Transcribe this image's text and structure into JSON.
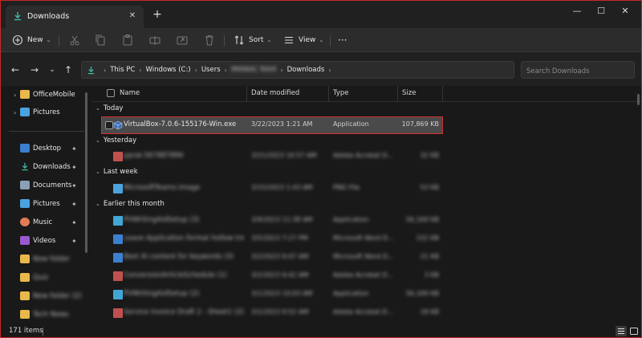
{
  "window": {
    "tab_title": "Downloads",
    "tab_close_glyph": "✕",
    "new_tab_glyph": "+",
    "minimize_glyph": "—",
    "maximize_glyph": "☐",
    "close_glyph": "✕"
  },
  "toolbar": {
    "new_label": "New",
    "sort_label": "Sort",
    "view_label": "View",
    "more_glyph": "···"
  },
  "address": {
    "crumbs": [
      "This PC",
      "Windows (C:)",
      "Users",
      "IMANAC RAHI",
      "Downloads"
    ],
    "search_placeholder": "Search Downloads"
  },
  "nav": {
    "items": [
      {
        "label": "OfficeMobile",
        "color": "#e8b84a"
      },
      {
        "label": "Pictures",
        "color": "#4aa3df"
      },
      {
        "label": "Desktop",
        "color": "#3b7fd0"
      },
      {
        "label": "Downloads",
        "color": "#3fb8a5"
      },
      {
        "label": "Documents",
        "color": "#8aa0b8"
      },
      {
        "label": "Pictures",
        "color": "#4aa3df"
      },
      {
        "label": "Music",
        "color": "#e07b54"
      },
      {
        "label": "Videos",
        "color": "#9b59d0"
      },
      {
        "label": "New folder",
        "color": "#e8b84a"
      },
      {
        "label": "Quiz",
        "color": "#e8b84a"
      },
      {
        "label": "New folder (2)",
        "color": "#e8b84a"
      },
      {
        "label": "Tech News",
        "color": "#e8b84a"
      }
    ]
  },
  "columns": {
    "name": "Name",
    "date": "Date modified",
    "type": "Type",
    "size": "Size"
  },
  "groups": {
    "today": "Today",
    "yesterday": "Yesterday",
    "last_week": "Last week",
    "earlier": "Earlier this month"
  },
  "files": {
    "selected": {
      "name": "VirtualBox-7.0.6-155176-Win.exe",
      "date": "3/22/2023 1:21 AM",
      "type": "Application",
      "size": "107,869 KB"
    },
    "yesterday": [
      {
        "name": "pprat-567887890",
        "date": "3/21/2023 10:57 AM",
        "type": "Adobe Acrobat D...",
        "size": "32 KB",
        "color": "#c0504d"
      }
    ],
    "last_week": [
      {
        "name": "MicrosoftTeams-image",
        "date": "3/15/2023 1:43 AM",
        "type": "PNG File",
        "size": "53 KB",
        "color": "#4aa3df"
      }
    ],
    "earlier": [
      {
        "name": "PVWritingAidSetup (3)",
        "date": "3/9/2023 11:38 AM",
        "type": "Application",
        "size": "56,169 KB",
        "color": "#3fa7d6"
      },
      {
        "name": "Leave Application format hollow tre...",
        "date": "3/5/2023 7:27 PM",
        "type": "Microsoft Word D...",
        "size": "152 KB",
        "color": "#3b7fd0"
      },
      {
        "name": "Best AI content for keywords (3)",
        "date": "3/2/2023 9:47 AM",
        "type": "Microsoft Word D...",
        "size": "21 KB",
        "color": "#3b7fd0"
      },
      {
        "name": "ConversionArticleSchedule (1)",
        "date": "3/2/2023 9:42 AM",
        "type": "Adobe Acrobat D...",
        "size": "3 KB",
        "color": "#c0504d"
      },
      {
        "name": "PVWritingAidSetup (2)",
        "date": "3/1/2023 10:03 AM",
        "type": "Application",
        "size": "56,169 KB",
        "color": "#3fa7d6"
      },
      {
        "name": "Service Invoice Draft 2 - Sheet1 (2)",
        "date": "3/1/2023 9:52 AM",
        "type": "Adobe Acrobat D...",
        "size": "18 KB",
        "color": "#c0504d"
      }
    ]
  },
  "status": {
    "count": "171 items"
  }
}
